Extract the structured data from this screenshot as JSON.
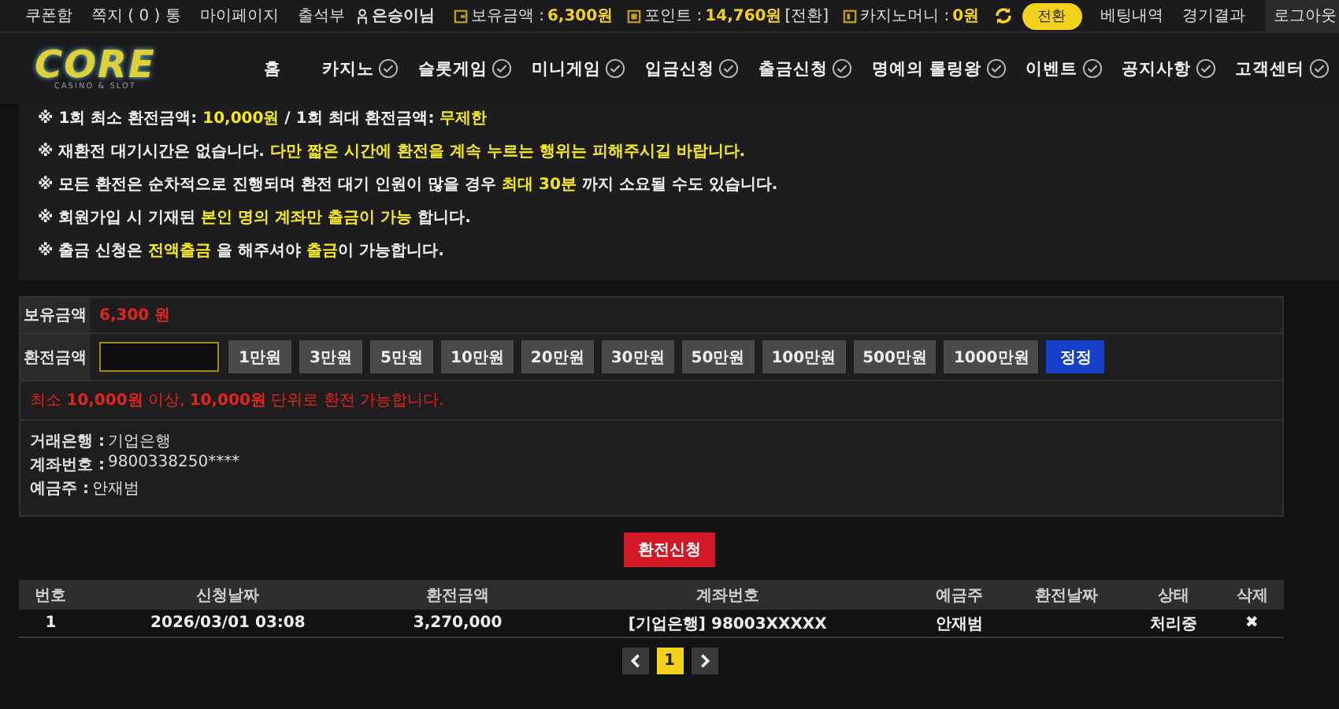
{
  "top_links": [
    "쿠폰함",
    "쪽지 ( 0 ) 통",
    "마이페이지",
    "출석부"
  ],
  "user": {
    "name": "은승이님",
    "balance_label": "보유금액 :",
    "balance": "6,300원",
    "point_label": "포인트 :",
    "point": "14,760원",
    "point_convert": "[전환]",
    "casino_label": "카지노머니 :",
    "casino": "0원",
    "convert_button": "전환"
  },
  "top_actions": [
    "베팅내역",
    "경기결과"
  ],
  "logout": "로그아웃",
  "logo": {
    "word": "CORE",
    "tagline": "CASINO & SLOT"
  },
  "nav": [
    {
      "label": "홈",
      "check": false
    },
    {
      "label": "카지노",
      "check": true
    },
    {
      "label": "슬롯게임",
      "check": true
    },
    {
      "label": "미니게임",
      "check": true
    },
    {
      "label": "입금신청",
      "check": true
    },
    {
      "label": "출금신청",
      "check": true
    },
    {
      "label": "명예의 롤링왕",
      "check": true
    },
    {
      "label": "이벤트",
      "check": true
    },
    {
      "label": "공지사항",
      "check": true
    },
    {
      "label": "고객센터",
      "check": true
    }
  ],
  "notices": [
    "※ 1회 최소 환전금액: **10,000원** / 1회 최대 환전금액: **무제한**",
    "※ 재환전 대기시간은 없습니다. **다만 짧은 시간에 환전을 계속 누르는 행위는 피해주시길 바랍니다.**",
    "※ 모든 환전은 순차적으로 진행되며 환전 대기 인원이 많을 경우 **최대 30분** 까지 소요될 수도 있습니다.",
    "※ 회원가입 시 기재된 **본인 명의 계좌만 출금이 가능** 합니다.",
    "※ 출금 신청은 **전액출금** 을 해주셔야 **출금**이 가능합니다."
  ],
  "form": {
    "balance_label": "보유금액",
    "balance": "6,300 원",
    "amount_label": "환전금액",
    "quick_amounts": [
      "1만원",
      "3만원",
      "5만원",
      "10만원",
      "20만원",
      "30만원",
      "50만원",
      "100만원",
      "500만원",
      "1000만원"
    ],
    "reset_button": "정정",
    "rule": "최소 **10,000원** 이상, **10,000원** 단위로 환전 가능합니다.",
    "bank": [
      {
        "label": "거래은행 :",
        "value": "기업은행"
      },
      {
        "label": "계좌번호 :",
        "value": "9800338250****"
      },
      {
        "label": "예금주 :",
        "value": "안재범"
      }
    ]
  },
  "submit_button": "환전신청",
  "table": {
    "columns": [
      "번호",
      "신청날짜",
      "환전금액",
      "계좌번호",
      "예금주",
      "환전날짜",
      "상태",
      "삭제"
    ],
    "rows": [
      {
        "number": "1",
        "requested": "2026/03/01 03:08",
        "amount": "3,270,000",
        "account": "[기업은행] 98003XXXXX",
        "holder": "안재범",
        "status": "처리중",
        "delete": "✖"
      }
    ]
  },
  "pagination": [
    {
      "label": "1",
      "selected": true
    }
  ]
}
